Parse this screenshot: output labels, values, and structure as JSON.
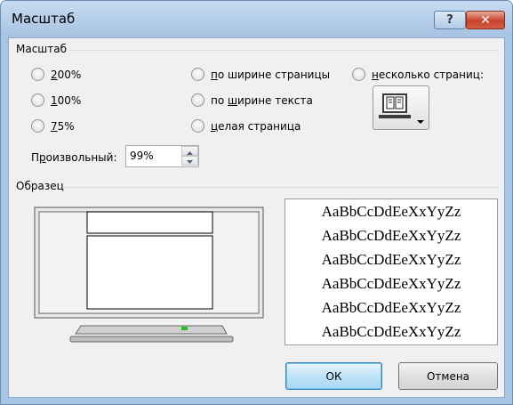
{
  "window": {
    "title": "Масштаб",
    "help_glyph": "?",
    "close_glyph": "✕"
  },
  "zoom_group": {
    "label": "Масштаб",
    "options": [
      {
        "pre": "",
        "mn": "2",
        "post": "00%"
      },
      {
        "pre": "",
        "mn": "1",
        "post": "00%"
      },
      {
        "pre": "",
        "mn": "7",
        "post": "5%"
      },
      {
        "pre": "",
        "mn": "п",
        "post": "о ширине страницы"
      },
      {
        "pre": "по ",
        "mn": "ш",
        "post": "ирине текста"
      },
      {
        "pre": "",
        "mn": "ц",
        "post": "елая страница"
      },
      {
        "pre": "",
        "mn": "н",
        "post": "есколько страниц:"
      }
    ],
    "percent": {
      "label_pre": "П",
      "label_mn": "р",
      "label_post": "оизвольный:",
      "value": "99%"
    }
  },
  "sample_group": {
    "label": "Образец",
    "sample_lines": [
      "AaBbCcDdEeXxYyZz",
      "AaBbCcDdEeXxYyZz",
      "AaBbCcDdEeXxYyZz",
      "AaBbCcDdEeXxYyZz",
      "AaBbCcDdEeXxYyZz",
      "AaBbCcDdEeXxYyZz"
    ]
  },
  "buttons": {
    "ok": "ОК",
    "cancel": "Отмена"
  }
}
